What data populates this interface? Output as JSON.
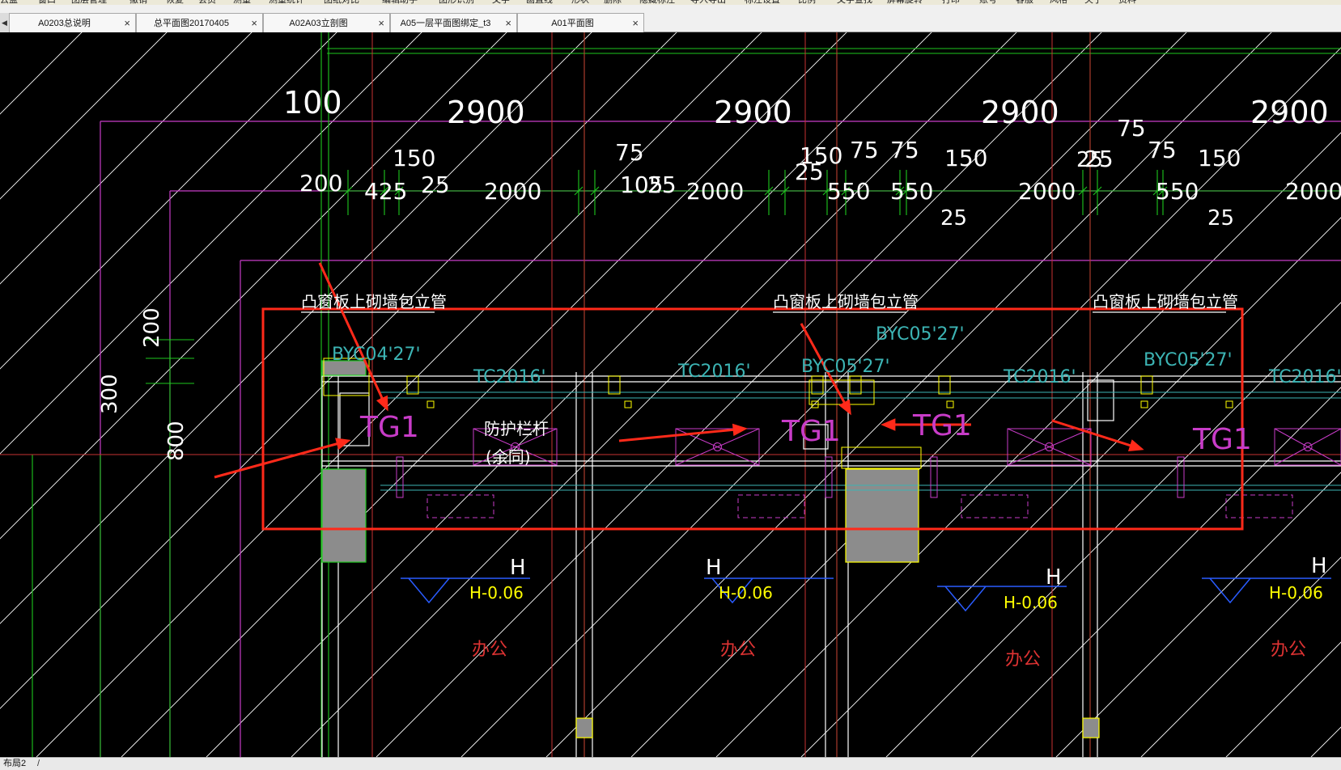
{
  "menu": {
    "items": [
      "云盘",
      "窗口",
      "图层管理",
      "撤销",
      "恢复",
      "会员",
      "测量",
      "测量统计",
      "图纸对比",
      "编辑助手",
      "图形识别",
      "文字",
      "画直线",
      "形状",
      "删除",
      "隐藏标注",
      "导入导出",
      "标注设置",
      "比例",
      "文字查找",
      "屏幕旋转",
      "打印",
      "账号",
      "客服",
      "风格",
      "关于",
      "资料"
    ]
  },
  "tabs": [
    {
      "label": "A0203总说明",
      "close": "×"
    },
    {
      "label": "总平面图20170405",
      "close": "×"
    },
    {
      "label": "A02A03立剖图",
      "close": "×"
    },
    {
      "label": "A05一层平面图绑定_t3",
      "close": "×"
    },
    {
      "label": "A01平面图",
      "close": "×"
    }
  ],
  "tab_nav": "◀",
  "drawing": {
    "top_dims": [
      "100",
      "2900",
      "2900",
      "2900",
      "2900"
    ],
    "sub_dims": [
      "150",
      "75",
      "150",
      "75",
      "75",
      "150",
      "75",
      "75",
      "150"
    ],
    "row_dims": [
      "200",
      "425",
      "25",
      "2000",
      "105",
      "25",
      "2000",
      "25",
      "550",
      "550",
      "2000",
      "25",
      "550",
      "2000"
    ],
    "small_dims": [
      "25",
      "25",
      "25"
    ],
    "left_dims": [
      "200",
      "300",
      "800"
    ],
    "notes": [
      "凸窗板上砌墙包立管",
      "凸窗板上砌墙包立管",
      "凸窗板上砌墙包立管"
    ],
    "window_tags": [
      "BYC04'27'",
      "BYC05'27'",
      "BYC05'27'",
      "BYC05'27'"
    ],
    "window_labels": [
      "TC2016'",
      "TC2016'",
      "TC2016'",
      "TC2016'"
    ],
    "tg_labels": [
      "TG1",
      "TG1",
      "TG1",
      "TG1"
    ],
    "railing": [
      "防护栏杆",
      "(余同)"
    ],
    "level_h": [
      "H",
      "H",
      "H",
      "H"
    ],
    "levels": [
      "H-0.06",
      "H-0.06",
      "H-0.06",
      "H-0.06"
    ],
    "rooms": [
      "办公",
      "办公",
      "办公",
      "办公"
    ]
  },
  "status": {
    "layout_tab": "布局2",
    "slash": "/"
  },
  "colors": {
    "bg": "#000000",
    "magenta": "#c83cc8",
    "green": "#1ec81e",
    "red_line": "#c83232",
    "white": "#ffffff",
    "yellow": "#ffff00",
    "cyan": "#3cb4b4",
    "highlight": "#ff2a1a"
  }
}
